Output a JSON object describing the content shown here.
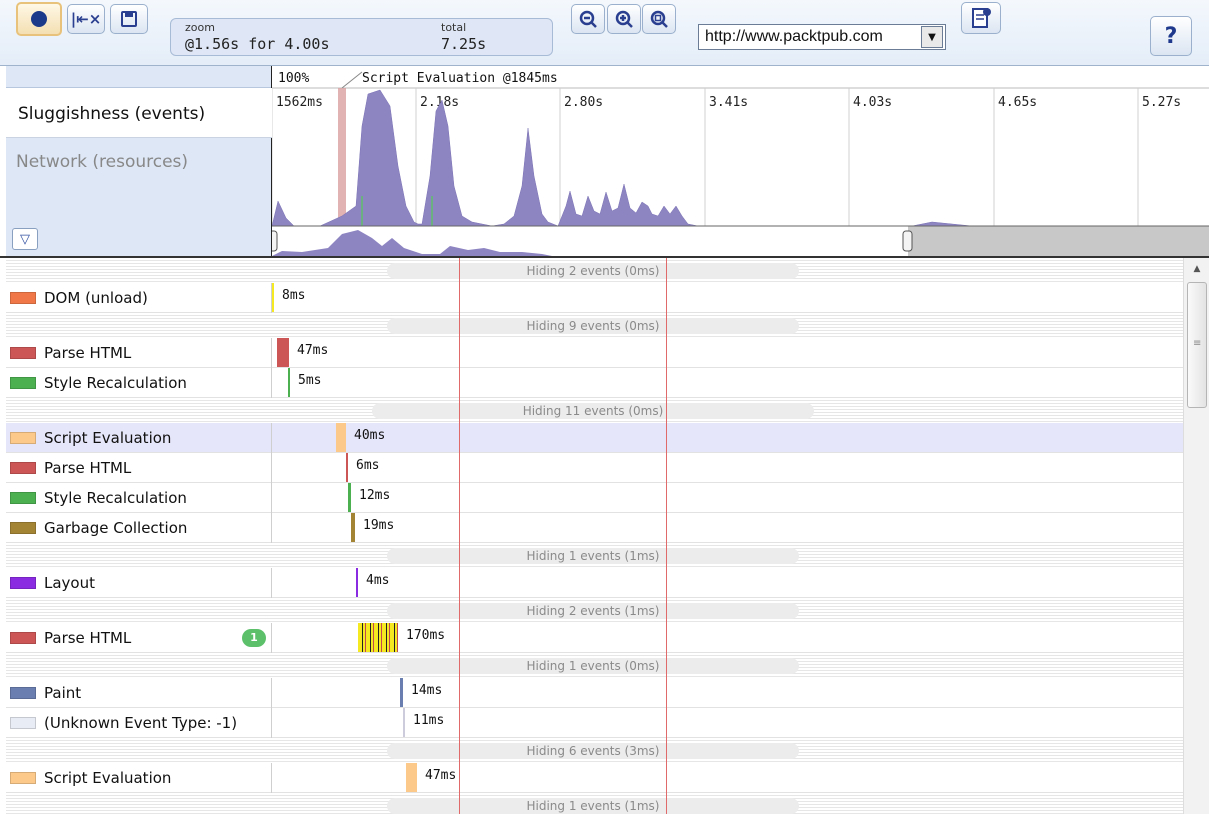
{
  "toolbar": {
    "zoom_label": "zoom",
    "zoom_value": "@1.56s for 4.00s",
    "total_label": "total",
    "total_value": "7.25s",
    "url_value": "http://www.packtpub.com",
    "help_label": "?",
    "icons": [
      "record-icon",
      "clear-icon",
      "save-icon",
      "zoom-out-icon",
      "zoom-in-icon",
      "zoom-fit-icon",
      "report-icon"
    ]
  },
  "overview": {
    "zoom_percent": "100%",
    "marker_label": "Script Evaluation @1845ms",
    "tabs": [
      {
        "label": "Sluggishness (events)"
      },
      {
        "label": "Network (resources)"
      }
    ],
    "ticks": [
      "1562ms",
      "2.18s",
      "2.80s",
      "3.41s",
      "4.03s",
      "4.65s",
      "5.27s"
    ]
  },
  "events": [
    {
      "type": "hide",
      "label": "Hiding 2 events (0ms)"
    },
    {
      "type": "event",
      "name": "DOM (unload)",
      "color": "#f07848",
      "bar": "#f5ea22",
      "duration": "8ms",
      "start": 0,
      "width": 2
    },
    {
      "type": "hide",
      "label": "Hiding 9 events (0ms)"
    },
    {
      "type": "event",
      "name": "Parse HTML",
      "color": "#cc5656",
      "bar": "#cc5656",
      "duration": "47ms",
      "start": 5,
      "width": 12
    },
    {
      "type": "event",
      "name": "Style Recalculation",
      "color": "#4caf50",
      "bar": "#4caf50",
      "duration": "5ms",
      "start": 16,
      "width": 2
    },
    {
      "type": "hide",
      "label": "Hiding 11 events (0ms)"
    },
    {
      "type": "event",
      "name": "Script Evaluation",
      "color": "#fcc98b",
      "bar": "#fcc98b",
      "duration": "40ms",
      "start": 64,
      "width": 10,
      "selected": true
    },
    {
      "type": "event",
      "name": "Parse HTML",
      "color": "#cc5656",
      "bar": "#cc5656",
      "duration": "6ms",
      "start": 74,
      "width": 2
    },
    {
      "type": "event",
      "name": "Style Recalculation",
      "color": "#4caf50",
      "bar": "#4caf50",
      "duration": "12ms",
      "start": 76,
      "width": 3
    },
    {
      "type": "event",
      "name": "Garbage Collection",
      "color": "#a38434",
      "bar": "#a38434",
      "duration": "19ms",
      "start": 79,
      "width": 4
    },
    {
      "type": "hide",
      "label": "Hiding 1 events (1ms)"
    },
    {
      "type": "event",
      "name": "Layout",
      "color": "#8a2be2",
      "bar": "#8a2be2",
      "duration": "4ms",
      "start": 84,
      "width": 2
    },
    {
      "type": "hide",
      "label": "Hiding 2 events (1ms)"
    },
    {
      "type": "event",
      "name": "Parse HTML",
      "color": "#cc5656",
      "bar": "#f5ea22",
      "duration": "170ms",
      "start": 86,
      "width": 40,
      "badge": "1",
      "striped": true
    },
    {
      "type": "hide",
      "label": "Hiding 1 events (0ms)"
    },
    {
      "type": "event",
      "name": "Paint",
      "color": "#6a7fb0",
      "bar": "#6a7fb0",
      "duration": "14ms",
      "start": 128,
      "width": 3
    },
    {
      "type": "event",
      "name": "(Unknown Event Type: -1)",
      "color": "#e8ecf4",
      "bar": "#e8ecf4",
      "duration": "11ms",
      "start": 131,
      "width": 2
    },
    {
      "type": "hide",
      "label": "Hiding 6 events (3ms)"
    },
    {
      "type": "event",
      "name": "Script Evaluation",
      "color": "#fcc98b",
      "bar": "#fcc98b",
      "duration": "47ms",
      "start": 134,
      "width": 11
    },
    {
      "type": "hide",
      "label": "Hiding 1 events (1ms)"
    }
  ]
}
